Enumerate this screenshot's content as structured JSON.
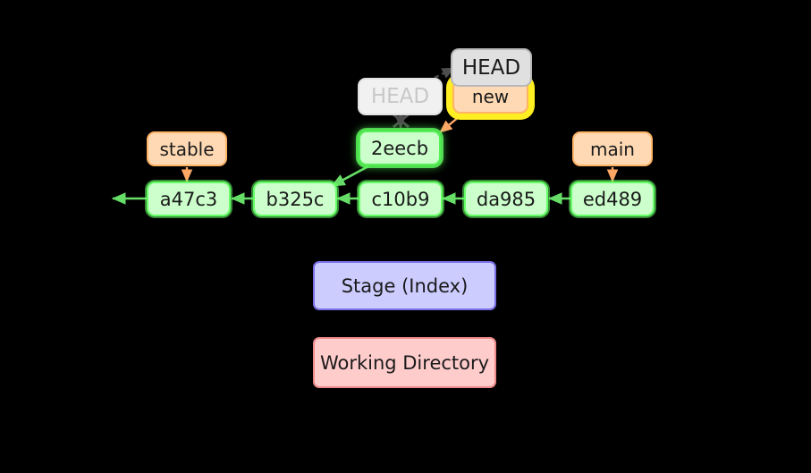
{
  "diagram": {
    "title": "git branch new / HEAD move visualization",
    "background_color": "#000000",
    "colors": {
      "commit_fill": "#ccffcc",
      "commit_border": "#66ff66",
      "branch_fill": "#ffd9b3",
      "branch_border": "#ffb366",
      "head_fill": "#e0e0e0",
      "head_border": "#b8b8b8",
      "head_ghost_fill": "#f1f1f1",
      "head_ghost_text": "#c8c8c8",
      "highlight_glow": "#ffee22",
      "stage_fill": "#ccccff",
      "stage_border": "#7b6fe8",
      "workdir_fill": "#ffcccc",
      "workdir_border": "#ef8a8a",
      "arrow_green": "#66dd66",
      "arrow_orange": "#ffa866",
      "arrow_gray": "#4d4d4d"
    }
  },
  "commits": [
    {
      "id": "a47c3",
      "label": "a47c3",
      "highlighted": false
    },
    {
      "id": "b325c",
      "label": "b325c",
      "highlighted": false
    },
    {
      "id": "c10b9",
      "label": "c10b9",
      "highlighted": false
    },
    {
      "id": "da985",
      "label": "da985",
      "highlighted": false
    },
    {
      "id": "ed489",
      "label": "ed489",
      "highlighted": false
    },
    {
      "id": "2eecb",
      "label": "2eecb",
      "highlighted": true
    }
  ],
  "branches": [
    {
      "id": "stable",
      "label": "stable",
      "points_to": "a47c3",
      "highlighted": false
    },
    {
      "id": "main",
      "label": "main",
      "points_to": "ed489",
      "highlighted": false
    },
    {
      "id": "new",
      "label": "new",
      "points_to": "2eecb",
      "highlighted": true
    }
  ],
  "head": {
    "active": {
      "label": "HEAD",
      "attached_to": "new",
      "state": "current"
    },
    "previous": {
      "label": "HEAD",
      "attached_to": "2eecb",
      "state": "ghost-detached"
    }
  },
  "areas": [
    {
      "id": "stage",
      "label": "Stage (Index)"
    },
    {
      "id": "workdir",
      "label": "Working Directory"
    }
  ],
  "edges": [
    {
      "from": "a47c3",
      "to": "parent-offscreen",
      "style": "solid",
      "color": "green"
    },
    {
      "from": "b325c",
      "to": "a47c3",
      "style": "solid",
      "color": "green"
    },
    {
      "from": "c10b9",
      "to": "b325c",
      "style": "solid",
      "color": "green"
    },
    {
      "from": "da985",
      "to": "c10b9",
      "style": "solid",
      "color": "green"
    },
    {
      "from": "ed489",
      "to": "da985",
      "style": "solid",
      "color": "green"
    },
    {
      "from": "2eecb",
      "to": "b325c",
      "style": "solid",
      "color": "green"
    },
    {
      "from": "stable",
      "to": "a47c3",
      "style": "solid",
      "color": "orange"
    },
    {
      "from": "main",
      "to": "ed489",
      "style": "solid",
      "color": "orange"
    },
    {
      "from": "new",
      "to": "2eecb",
      "style": "solid",
      "color": "orange"
    },
    {
      "from": "head-ghost",
      "to": "head-active",
      "style": "dashed",
      "color": "gray"
    },
    {
      "from": "head-ghost",
      "to": "2eecb",
      "style": "crossed-out",
      "color": "gray"
    }
  ]
}
